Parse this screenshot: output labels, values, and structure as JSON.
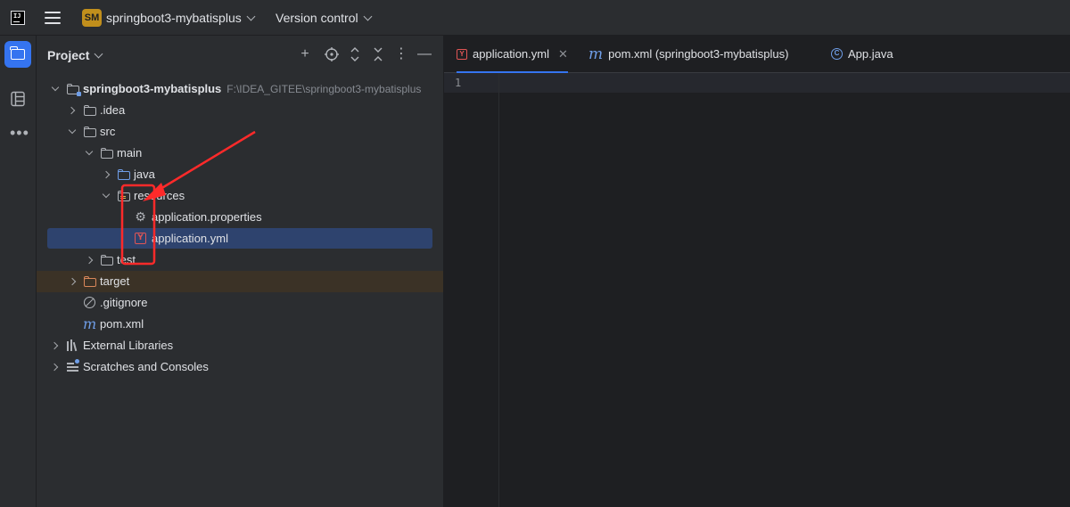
{
  "titlebar": {
    "logo_text": "IJ",
    "project_badge": "SM",
    "project_name": "springboot3-mybatisplus",
    "vcs_label": "Version control"
  },
  "panel": {
    "title": "Project",
    "actions": [
      "add-icon",
      "locate-icon",
      "expand-icon",
      "collapse-icon",
      "more-icon",
      "minimize-icon"
    ]
  },
  "tree": {
    "root": {
      "label": "springboot3-mybatisplus",
      "path": "F:\\IDEA_GITEE\\springboot3-mybatisplus"
    },
    "idea": ".idea",
    "src": "src",
    "main": "main",
    "java": "java",
    "resources": "resources",
    "app_properties": "application.properties",
    "app_yml": "application.yml",
    "test": "test",
    "target": "target",
    "gitignore": ".gitignore",
    "pom": "pom.xml",
    "external_libraries": "External Libraries",
    "scratches": "Scratches and Consoles"
  },
  "editor": {
    "tabs": [
      {
        "label": "application.yml",
        "icon": "yaml-icon",
        "active": true
      },
      {
        "label": "pom.xml (springboot3-mybatisplus)",
        "icon": "maven-icon"
      },
      {
        "label": "App.java",
        "icon": "class-icon"
      }
    ],
    "line_number": "1"
  },
  "icons": {
    "yaml_glyph": "Y",
    "maven_glyph": "m",
    "class_glyph": "C"
  },
  "colors": {
    "accent": "#3574f0",
    "selection": "#2e436e",
    "annotation": "#ff2a2a",
    "project_badge": "#c18f1c"
  }
}
